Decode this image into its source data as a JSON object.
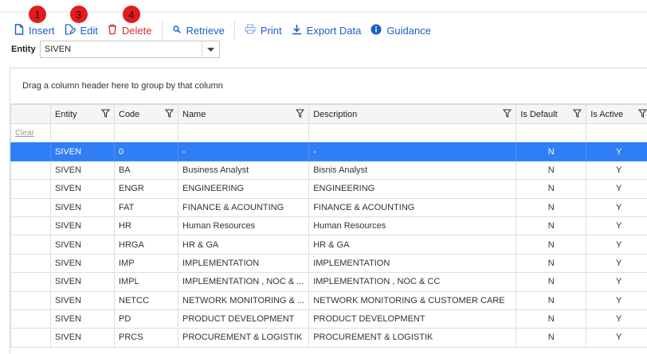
{
  "toolbar": {
    "insert": "Insert",
    "edit": "Edit",
    "delete": "Delete",
    "retrieve": "Retrieve",
    "print": "Print",
    "export": "Export Data",
    "guidance": "Guidance",
    "step_insert": "1",
    "step_edit": "3",
    "step_delete": "4",
    "link_color": "#1a5fc7",
    "danger_color": "#d32f2f"
  },
  "entity_filter": {
    "label": "Entity",
    "value": "SIVEN"
  },
  "grid": {
    "group_hint": "Drag a column header here to group by that column",
    "clear_label": "Clear",
    "columns": [
      "Entity",
      "Code",
      "Name",
      "Description",
      "Is Default",
      "Is Active"
    ],
    "rows": [
      [
        "SIVEN",
        "0",
        "-",
        "-",
        "N",
        "Y"
      ],
      [
        "SIVEN",
        "BA",
        "Business Analyst",
        "Bisnis Analyst",
        "N",
        "Y"
      ],
      [
        "SIVEN",
        "ENGR",
        "ENGINEERING",
        "ENGINEERING",
        "N",
        "Y"
      ],
      [
        "SIVEN",
        "FAT",
        "FINANCE & ACOUNTING",
        "FINANCE & ACOUNTING",
        "N",
        "Y"
      ],
      [
        "SIVEN",
        "HR",
        "Human Resources",
        "Human Resources",
        "N",
        "Y"
      ],
      [
        "SIVEN",
        "HRGA",
        "HR & GA",
        "HR & GA",
        "N",
        "Y"
      ],
      [
        "SIVEN",
        "IMP",
        "IMPLEMENTATION",
        "IMPLEMENTATION",
        "N",
        "Y"
      ],
      [
        "SIVEN",
        "IMPL",
        "IMPLEMENTATION , NOC & ...",
        "IMPLEMENTATION , NOC & CC",
        "N",
        "Y"
      ],
      [
        "SIVEN",
        "NETCC",
        "NETWORK MONITORING & ...",
        "NETWORK MONITORING & CUSTOMER CARE",
        "N",
        "Y"
      ],
      [
        "SIVEN",
        "PD",
        "PRODUCT DEVELOPMENT",
        "PRODUCT DEVELOPMENT",
        "N",
        "Y"
      ],
      [
        "SIVEN",
        "PRCS",
        "PROCUREMENT & LOGISTIK",
        "PROCUREMENT & LOGISTIK",
        "N",
        "Y"
      ]
    ],
    "selected_row": 0,
    "selected_color": "#2f7ef5"
  }
}
